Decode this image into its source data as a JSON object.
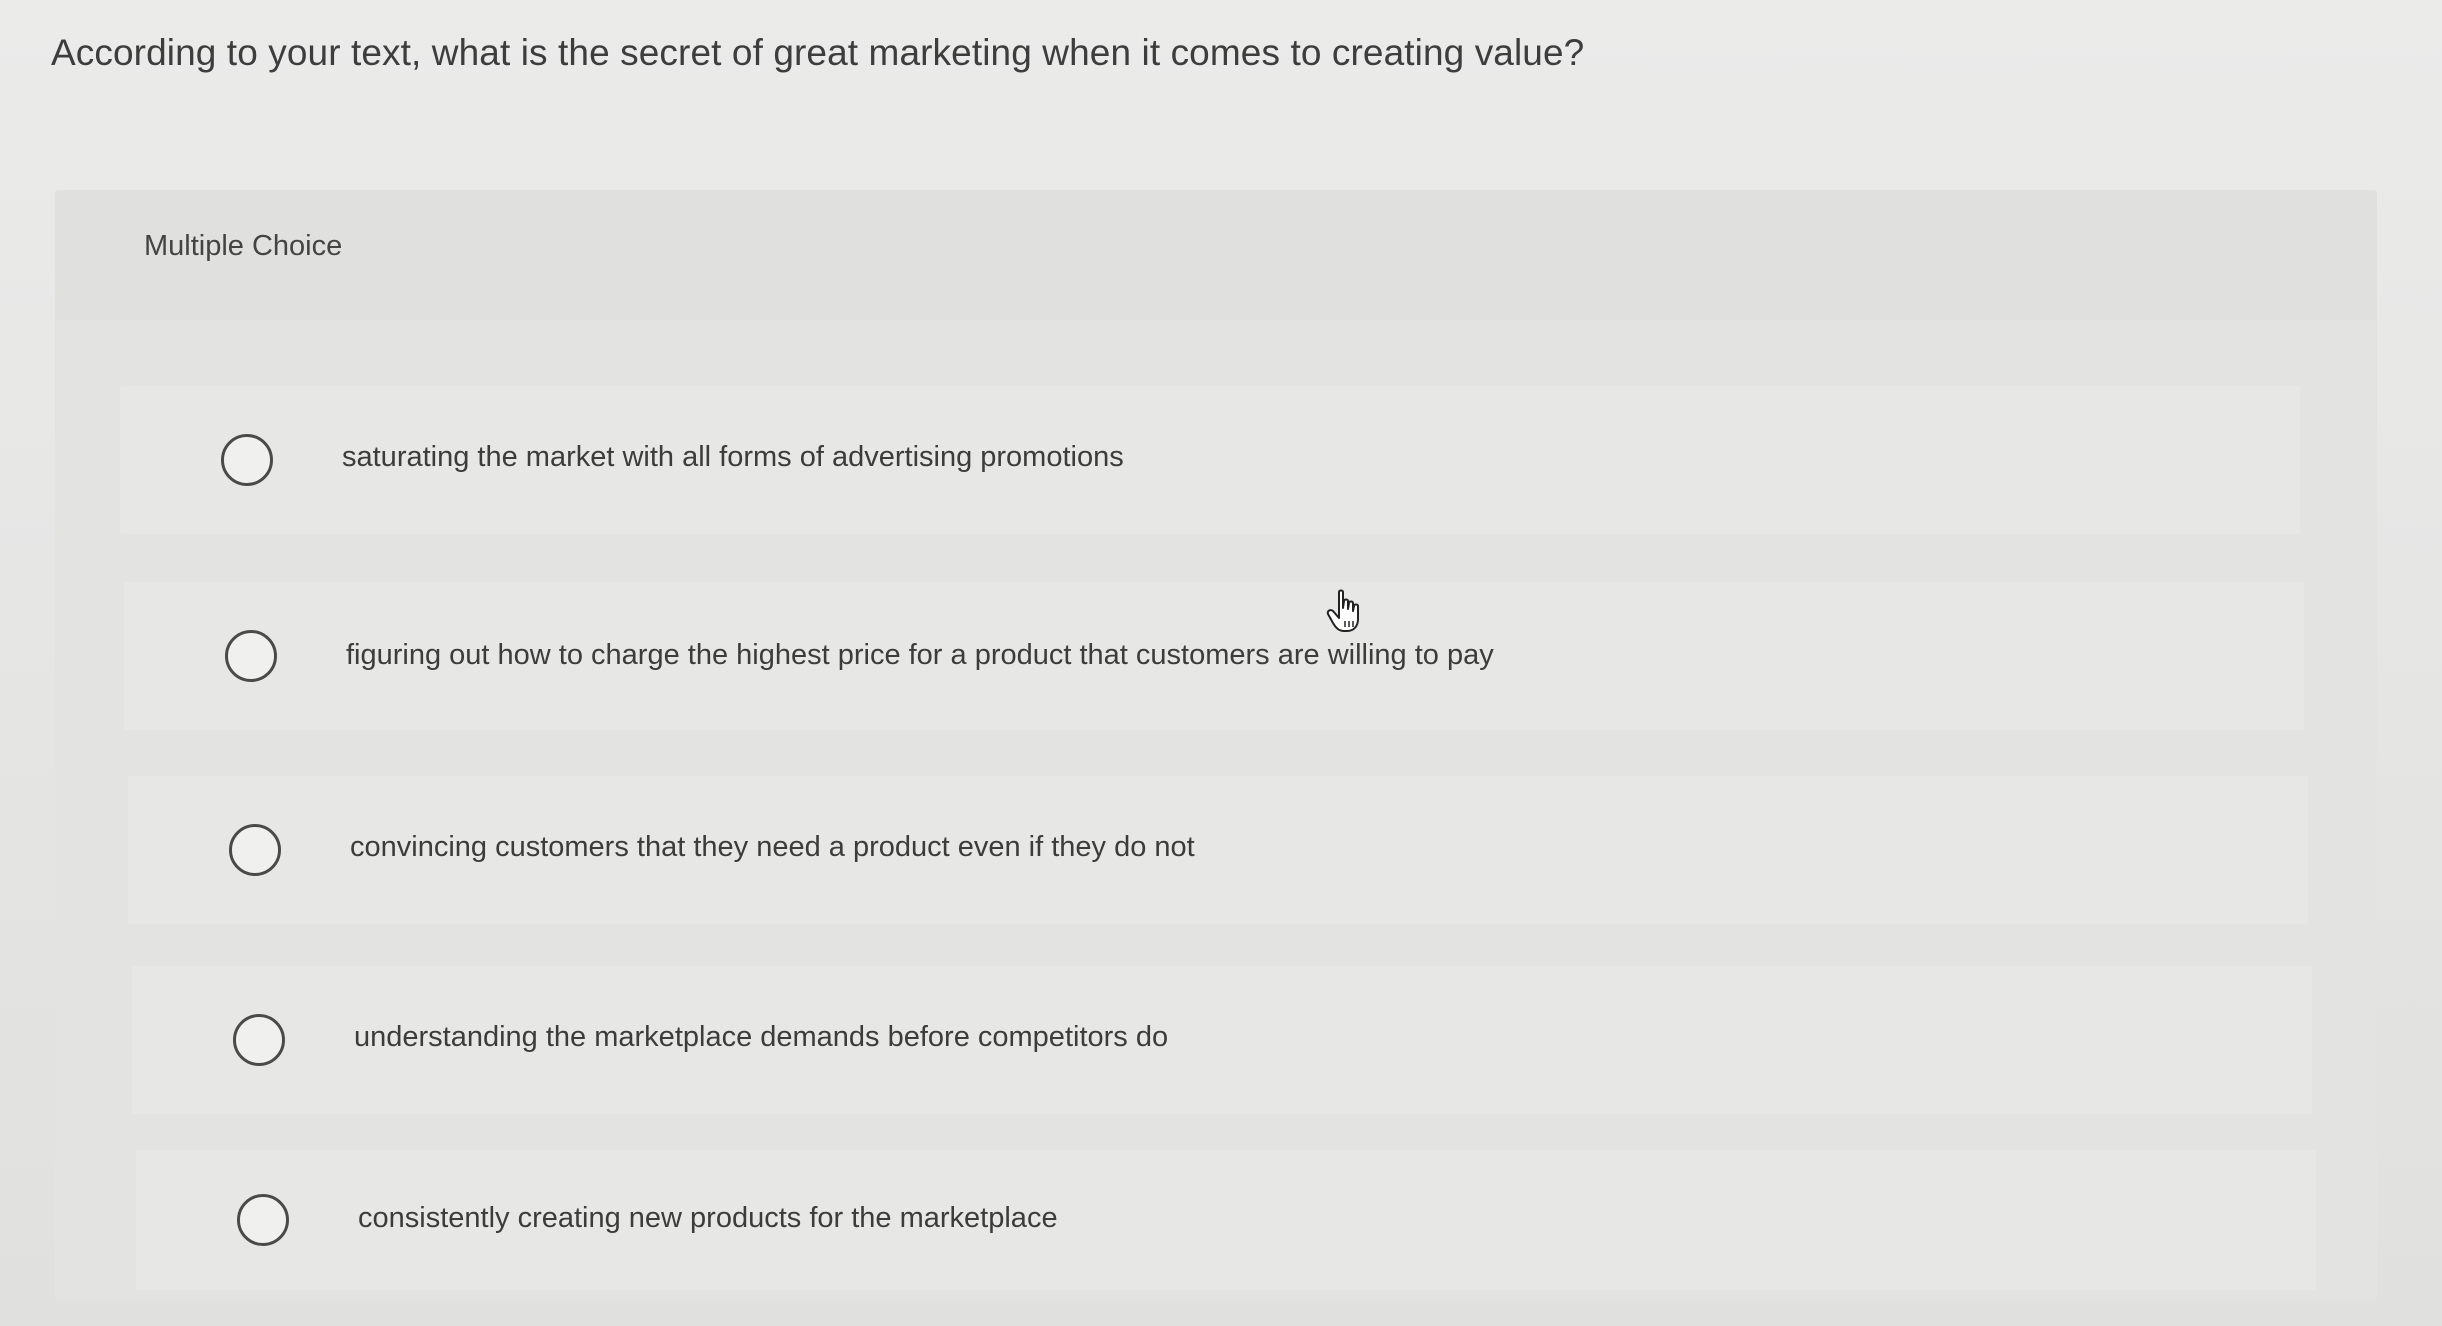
{
  "question": {
    "text": "According to your text, what is the secret of great marketing when it comes to creating value?"
  },
  "panel": {
    "label": "Multiple Choice"
  },
  "options": [
    {
      "label": "saturating the market with all forms of advertising promotions",
      "selected": false
    },
    {
      "label": "figuring out how to charge the highest price for a product that customers are willing to pay",
      "selected": false
    },
    {
      "label": "convincing customers that they need a product even if they do not",
      "selected": false
    },
    {
      "label": "understanding the marketplace demands before competitors do",
      "selected": false
    },
    {
      "label": "consistently creating new products for the marketplace",
      "selected": false
    }
  ],
  "cursor": {
    "icon": "hand-pointer-icon"
  }
}
